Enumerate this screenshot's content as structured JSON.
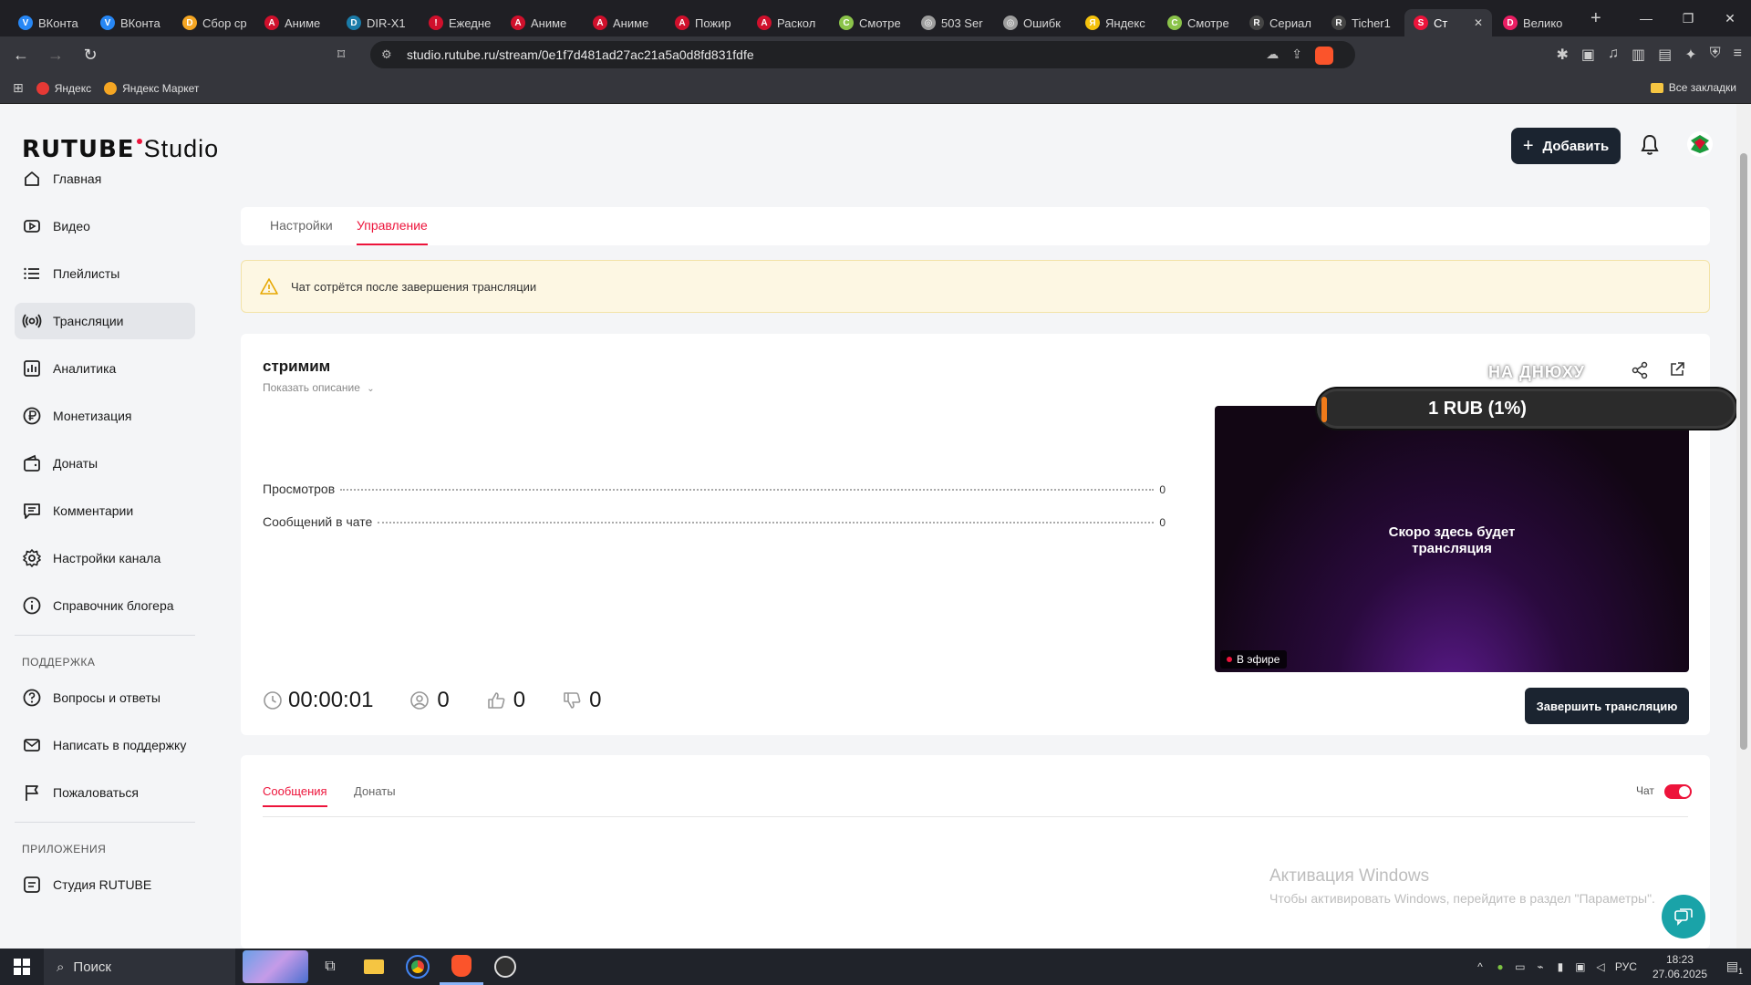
{
  "browser": {
    "tabs": [
      {
        "label": "ВКонта",
        "color": "#2787f5",
        "glyph": "V"
      },
      {
        "label": "ВКонта",
        "color": "#2787f5",
        "glyph": "V"
      },
      {
        "label": "Сбор ср",
        "color": "#f5a623",
        "glyph": "D"
      },
      {
        "label": "Аниме",
        "color": "#d0102c",
        "glyph": "A"
      },
      {
        "label": "DIR-X1",
        "color": "#1a7ba8",
        "glyph": "D"
      },
      {
        "label": "Ежедне",
        "color": "#d0102c",
        "glyph": "!"
      },
      {
        "label": "Аниме",
        "color": "#d0102c",
        "glyph": "A"
      },
      {
        "label": "Аниме",
        "color": "#d0102c",
        "glyph": "A"
      },
      {
        "label": "Пожир",
        "color": "#d0102c",
        "glyph": "A"
      },
      {
        "label": "Раскол",
        "color": "#d0102c",
        "glyph": "A"
      },
      {
        "label": "Смотре",
        "color": "#8bc34a",
        "glyph": "С"
      },
      {
        "label": "503 Ser",
        "color": "#9e9e9e",
        "glyph": "◎"
      },
      {
        "label": "Ошибк",
        "color": "#9e9e9e",
        "glyph": "◎"
      },
      {
        "label": "Яндекс",
        "color": "#f4c20d",
        "glyph": "Я"
      },
      {
        "label": "Смотре",
        "color": "#8bc34a",
        "glyph": "С"
      },
      {
        "label": "Сериал",
        "color": "#444",
        "glyph": "R"
      },
      {
        "label": "Ticher1",
        "color": "#444",
        "glyph": "R"
      },
      {
        "label": "Ст",
        "color": "#ed143b",
        "glyph": "S",
        "active": true
      },
      {
        "label": "Велико",
        "color": "#e91e63",
        "glyph": "D"
      }
    ],
    "url": "studio.rutube.ru/stream/0e1f7d481ad27ac21a5a0d8fd831fdfe",
    "bookmarks": [
      {
        "label": "Яндекс",
        "color": "#e53935"
      },
      {
        "label": "Яндекс Маркет",
        "color": "#f5a623"
      }
    ],
    "all_bookmarks": "Все закладки"
  },
  "header": {
    "logo_brand": "RUTUBE",
    "logo_studio": "Studio",
    "add_button": "Добавить"
  },
  "sidebar": {
    "items": [
      {
        "label": "Главная",
        "icon": "home-icon"
      },
      {
        "label": "Видео",
        "icon": "video-icon"
      },
      {
        "label": "Плейлисты",
        "icon": "playlist-icon"
      },
      {
        "label": "Трансляции",
        "icon": "broadcast-icon",
        "active": true
      },
      {
        "label": "Аналитика",
        "icon": "analytics-icon"
      },
      {
        "label": "Монетизация",
        "icon": "ruble-icon"
      },
      {
        "label": "Донаты",
        "icon": "wallet-icon"
      },
      {
        "label": "Комментарии",
        "icon": "comments-icon"
      },
      {
        "label": "Настройки канала",
        "icon": "gear-icon"
      },
      {
        "label": "Справочник блогера",
        "icon": "info-icon"
      }
    ],
    "support_title": "ПОДДЕРЖКА",
    "support_items": [
      {
        "label": "Вопросы и ответы",
        "icon": "question-icon"
      },
      {
        "label": "Написать в поддержку",
        "icon": "mail-icon"
      },
      {
        "label": "Пожаловаться",
        "icon": "flag-icon"
      }
    ],
    "apps_title": "ПРИЛОЖЕНИЯ",
    "apps_items": [
      {
        "label": "Студия RUTUBE",
        "icon": "studio-app-icon"
      }
    ]
  },
  "page_tabs": {
    "settings": "Настройки",
    "manage": "Управление"
  },
  "notice": "Чат сотрётся после завершения трансляции",
  "stream": {
    "title": "стримим",
    "show_description": "Показать описание",
    "stats": [
      {
        "label": "Просмотров",
        "value": "0"
      },
      {
        "label": "Сообщений в чате",
        "value": "0"
      }
    ],
    "duration": "00:00:01",
    "viewers": "0",
    "likes": "0",
    "dislikes": "0",
    "overlay_label": "НА ДНЮХУ",
    "donation_goal": "1 RUB (1%)",
    "donation_progress_percent": 1,
    "player_message_1": "Скоро здесь будет",
    "player_message_2": "трансляция",
    "live_badge": "В эфире",
    "end_button": "Завершить трансляцию"
  },
  "chat": {
    "tab_messages": "Сообщения",
    "tab_donations": "Донаты",
    "toggle_label": "Чат",
    "toggle_on": true
  },
  "watermark": {
    "line1": "Активация Windows",
    "line2": "Чтобы активировать Windows, перейдите в раздел \"Параметры\"."
  },
  "taskbar": {
    "search_placeholder": "Поиск",
    "lang": "РУС",
    "time": "18:23",
    "date": "27.06.2025",
    "notif_count": "1"
  },
  "colors": {
    "accent": "#ed143b",
    "dark_button": "#1b2430",
    "notice_bg": "#fdf7e3"
  }
}
